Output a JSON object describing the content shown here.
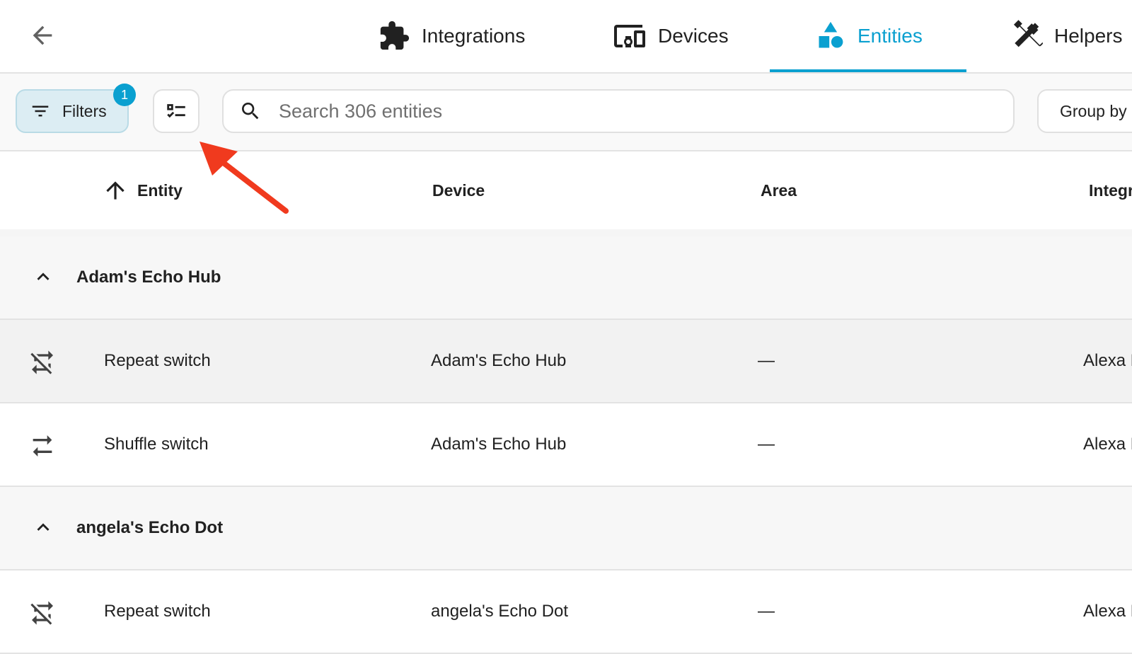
{
  "nav": {
    "back_icon": "arrow-left-icon",
    "tabs": [
      {
        "label": "Integrations",
        "icon": "puzzle-icon",
        "active": false
      },
      {
        "label": "Devices",
        "icon": "devices-icon",
        "active": false
      },
      {
        "label": "Entities",
        "icon": "shapes-icon",
        "active": true
      },
      {
        "label": "Helpers",
        "icon": "tools-icon",
        "active": false
      }
    ],
    "accent_color": "#0aa0d0"
  },
  "toolbar": {
    "filters_label": "Filters",
    "filters_count": "1",
    "search_placeholder": "Search 306 entities",
    "search_value": "",
    "group_label": "Group by"
  },
  "table": {
    "columns": [
      "Entity",
      "Device",
      "Area",
      "Integration"
    ],
    "sort": {
      "column": "Entity",
      "direction": "ascending"
    },
    "groups": [
      {
        "name": "Adam's Echo Hub",
        "rows": [
          {
            "icon": "repeat-off-icon",
            "entity": "Repeat switch",
            "device": "Adam's Echo Hub",
            "area": "—",
            "integration": "Alexa Media Player"
          },
          {
            "icon": "shuffle-disabled-icon",
            "entity": "Shuffle switch",
            "device": "Adam's Echo Hub",
            "area": "—",
            "integration": "Alexa Media Player"
          }
        ]
      },
      {
        "name": "angela's Echo Dot",
        "rows": [
          {
            "icon": "repeat-off-icon",
            "entity": "Repeat switch",
            "device": "angela's Echo Dot",
            "area": "—",
            "integration": "Alexa Media Player"
          }
        ]
      }
    ]
  },
  "annotation": {
    "arrow_color": "#f03a1e"
  }
}
